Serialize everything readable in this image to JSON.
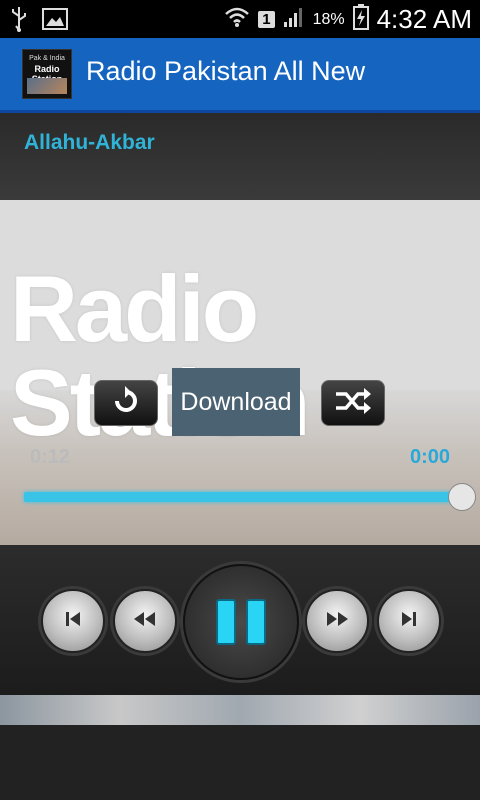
{
  "status_bar": {
    "battery_percent": "18%",
    "time": "4:32 AM",
    "sim_label": "1",
    "icons": [
      "usb-icon",
      "image-icon",
      "wifi-icon",
      "sim-icon",
      "signal-icon",
      "battery-icon"
    ]
  },
  "app": {
    "title": "Radio Pakistan All New",
    "icon_line1": "Pak & India",
    "icon_line2": "Radio Station"
  },
  "player": {
    "song_title": "Allahu-Akbar",
    "artwork_text": "Radio Station",
    "download_label": "Download",
    "elapsed": "0:12",
    "duration": "0:00",
    "seek_fraction": 1.0
  },
  "colors": {
    "appbar": "#1565c0",
    "accent": "#2fb3d6",
    "download_bg": "#4a6272"
  }
}
